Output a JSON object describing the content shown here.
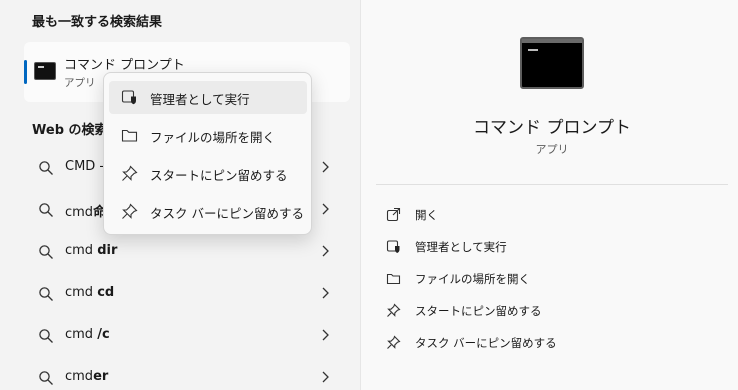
{
  "left": {
    "best_match_title": "最も一致する検索結果",
    "best_match": {
      "name": "コマンド プロンプト",
      "type": "アプリ"
    },
    "web_title": "Web の検索",
    "web_items": [
      {
        "prefix": "CMD -",
        "bold": ""
      },
      {
        "prefix": "cmd",
        "bold": "命"
      },
      {
        "prefix": "cmd ",
        "bold": "dir"
      },
      {
        "prefix": "cmd ",
        "bold": "cd"
      },
      {
        "prefix": "cmd ",
        "bold": "/c"
      },
      {
        "prefix": "cmd",
        "bold": "er"
      }
    ]
  },
  "context_menu": {
    "items": [
      {
        "label": "管理者として実行",
        "icon": "shield-icon"
      },
      {
        "label": "ファイルの場所を開く",
        "icon": "folder-icon"
      },
      {
        "label": "スタートにピン留めする",
        "icon": "pin-icon"
      },
      {
        "label": "タスク バーにピン留めする",
        "icon": "pin-icon"
      }
    ]
  },
  "detail": {
    "title": "コマンド プロンプト",
    "subtitle": "アプリ",
    "actions": [
      {
        "label": "開く",
        "icon": "open-external-icon"
      },
      {
        "label": "管理者として実行",
        "icon": "shield-icon"
      },
      {
        "label": "ファイルの場所を開く",
        "icon": "folder-icon"
      },
      {
        "label": "スタートにピン留めする",
        "icon": "pin-icon"
      },
      {
        "label": "タスク バーにピン留めする",
        "icon": "pin-icon"
      }
    ]
  },
  "colors": {
    "accent": "#0067c0",
    "hover": "#ebebeb",
    "panel": "#f9f9f9"
  }
}
